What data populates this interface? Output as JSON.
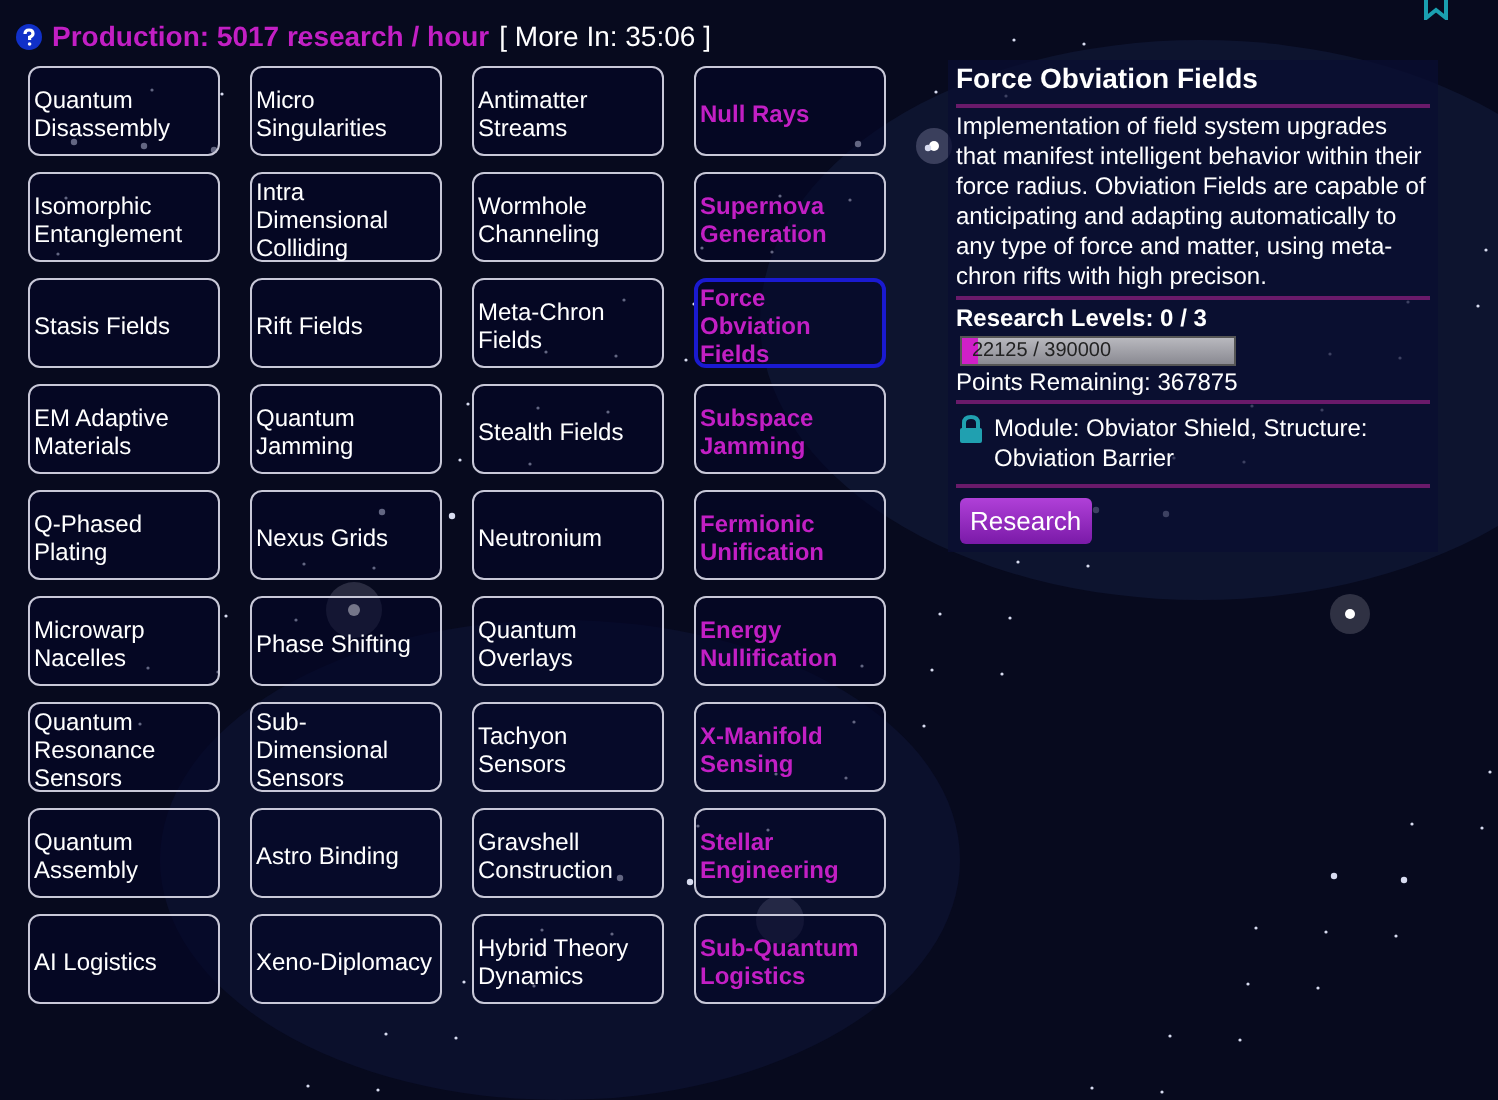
{
  "header": {
    "production": "Production: 5017 research / hour",
    "timer": "[ More In: 35:06 ]"
  },
  "techs": [
    {
      "label": "Quantum Disassembly",
      "kind": "normal",
      "selected": false
    },
    {
      "label": "Micro Singularities",
      "kind": "normal",
      "selected": false
    },
    {
      "label": "Antimatter Streams",
      "kind": "normal",
      "selected": false
    },
    {
      "label": "Null Rays",
      "kind": "highlight",
      "selected": false
    },
    {
      "label": "Isomorphic Entanglement",
      "kind": "normal",
      "selected": false
    },
    {
      "label": "Intra Dimensional Colliding",
      "kind": "normal",
      "selected": false
    },
    {
      "label": "Wormhole Channeling",
      "kind": "normal",
      "selected": false
    },
    {
      "label": "Supernova Generation",
      "kind": "highlight",
      "selected": false
    },
    {
      "label": "Stasis Fields",
      "kind": "normal",
      "selected": false
    },
    {
      "label": "Rift Fields",
      "kind": "normal",
      "selected": false
    },
    {
      "label": "Meta-Chron Fields",
      "kind": "normal",
      "selected": false
    },
    {
      "label": "Force Obviation Fields",
      "kind": "highlight",
      "selected": true
    },
    {
      "label": "EM Adaptive Materials",
      "kind": "normal",
      "selected": false
    },
    {
      "label": "Quantum Jamming",
      "kind": "normal",
      "selected": false
    },
    {
      "label": "Stealth Fields",
      "kind": "normal",
      "selected": false
    },
    {
      "label": "Subspace Jamming",
      "kind": "highlight",
      "selected": false
    },
    {
      "label": "Q-Phased Plating",
      "kind": "normal",
      "selected": false
    },
    {
      "label": "Nexus Grids",
      "kind": "normal",
      "selected": false
    },
    {
      "label": "Neutronium",
      "kind": "normal",
      "selected": false
    },
    {
      "label": "Fermionic Unification",
      "kind": "highlight",
      "selected": false
    },
    {
      "label": "Microwarp Nacelles",
      "kind": "normal",
      "selected": false
    },
    {
      "label": "Phase Shifting",
      "kind": "normal",
      "selected": false
    },
    {
      "label": "Quantum Overlays",
      "kind": "normal",
      "selected": false
    },
    {
      "label": "Energy Nullification",
      "kind": "highlight",
      "selected": false
    },
    {
      "label": "Quantum Resonance Sensors",
      "kind": "normal",
      "selected": false
    },
    {
      "label": "Sub-Dimensional Sensors",
      "kind": "normal",
      "selected": false
    },
    {
      "label": "Tachyon Sensors",
      "kind": "normal",
      "selected": false
    },
    {
      "label": "X-Manifold Sensing",
      "kind": "highlight",
      "selected": false
    },
    {
      "label": "Quantum Assembly",
      "kind": "normal",
      "selected": false
    },
    {
      "label": "Astro Binding",
      "kind": "normal",
      "selected": false
    },
    {
      "label": "Gravshell Construction",
      "kind": "normal",
      "selected": false
    },
    {
      "label": "Stellar Engineering",
      "kind": "highlight",
      "selected": false
    },
    {
      "label": "AI Logistics",
      "kind": "normal",
      "selected": false
    },
    {
      "label": "Xeno-Diplomacy",
      "kind": "normal",
      "selected": false
    },
    {
      "label": "Hybrid Theory Dynamics",
      "kind": "normal",
      "selected": false
    },
    {
      "label": "Sub-Quantum Logistics",
      "kind": "highlight",
      "selected": false
    }
  ],
  "detail": {
    "title": "Force Obviation Fields",
    "description": "Implementation of field system upgrades that manifest intelligent behavior within their force radius. Obviation Fields are capable of anticipating and adapting automatically to any type of force and matter, using meta-chron rifts with high precison.",
    "levels": "Research Levels: 0 / 3",
    "progress": {
      "level": 0.0567,
      "reading": "22125 / 390000"
    },
    "remaining": "Points Remaining: 367875",
    "unlocks": "Module: Obviator Shield, Structure: Obviation Barrier",
    "button": "Research"
  }
}
